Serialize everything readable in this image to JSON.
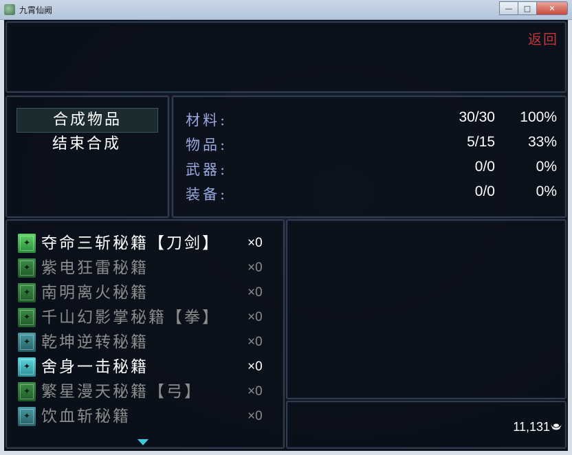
{
  "window": {
    "title": "九霄仙阙",
    "minimize": "—",
    "maximize": "□",
    "close": "✕"
  },
  "header": {
    "back_label": "返回"
  },
  "menu": {
    "items": [
      {
        "label": "合成物品",
        "selected": true
      },
      {
        "label": "结束合成",
        "selected": false
      }
    ]
  },
  "stats": [
    {
      "label": "材料:",
      "value": "30/30",
      "percent": "100%"
    },
    {
      "label": "物品:",
      "value": "5/15",
      "percent": "33%"
    },
    {
      "label": "武器:",
      "value": "0/0",
      "percent": "0%"
    },
    {
      "label": "装备:",
      "value": "0/0",
      "percent": "0%"
    }
  ],
  "items": [
    {
      "name": "夺命三斩秘籍【刀剑】",
      "qty": "×0",
      "enabled": true,
      "icon": "green-scroll-icon",
      "color": "#5fd36a"
    },
    {
      "name": "紫电狂雷秘籍",
      "qty": "×0",
      "enabled": false,
      "icon": "green-scroll-icon",
      "color": "#3d8d47"
    },
    {
      "name": "南明离火秘籍",
      "qty": "×0",
      "enabled": false,
      "icon": "green-scroll-icon",
      "color": "#3d8d47"
    },
    {
      "name": "千山幻影掌秘籍【拳】",
      "qty": "×0",
      "enabled": false,
      "icon": "green-scroll-icon",
      "color": "#3d8d47"
    },
    {
      "name": "乾坤逆转秘籍",
      "qty": "×0",
      "enabled": false,
      "icon": "cyan-scroll-icon",
      "color": "#4a9ba3"
    },
    {
      "name": "舍身一击秘籍",
      "qty": "×0",
      "enabled": true,
      "icon": "cyan-scroll-icon",
      "color": "#5ed7e0"
    },
    {
      "name": "繁星漫天秘籍【弓】",
      "qty": "×0",
      "enabled": false,
      "icon": "green-scroll-icon",
      "color": "#3d8d47"
    },
    {
      "name": "饮血斩秘籍",
      "qty": "×0",
      "enabled": false,
      "icon": "cyan-scroll-icon",
      "color": "#4a9ba3"
    }
  ],
  "gold": {
    "amount": "11,131",
    "icon": "ingot-icon"
  },
  "colors": {
    "back": "#c0343a",
    "stat_label": "#9aa9e0",
    "scroll_arrow": "#3ec8e0"
  }
}
